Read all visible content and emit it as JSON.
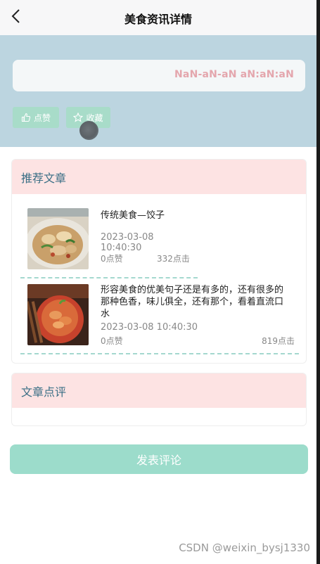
{
  "header": {
    "title": "美食资讯详情"
  },
  "detail": {
    "time_display": "NaN-aN-aN aN:aN:aN",
    "like_button": "点赞",
    "favorite_button": "收藏"
  },
  "recommended": {
    "heading": "推荐文章",
    "articles": [
      {
        "title": "传统美食—饺子",
        "date": "2023-03-08 10:40:30",
        "likes": "0点赞",
        "clicks": "332点击"
      },
      {
        "title": "形容美食的优美句子还是有多的，还有很多的那种色香，味儿俱全，还有那个，看着直流口水",
        "date": "2023-03-08 10:40:30",
        "likes": "0点赞",
        "clicks": "819点击"
      }
    ]
  },
  "comments": {
    "heading": "文章点评"
  },
  "submit": {
    "label": "发表评论"
  },
  "watermark": "CSDN @weixin_bysj1330",
  "colors": {
    "band": "#bcd5e0",
    "accent_green": "#a8dcc9",
    "section_header": "#fde3e3",
    "heading_text": "#3a6f86",
    "time_text": "#e4a6ad"
  }
}
